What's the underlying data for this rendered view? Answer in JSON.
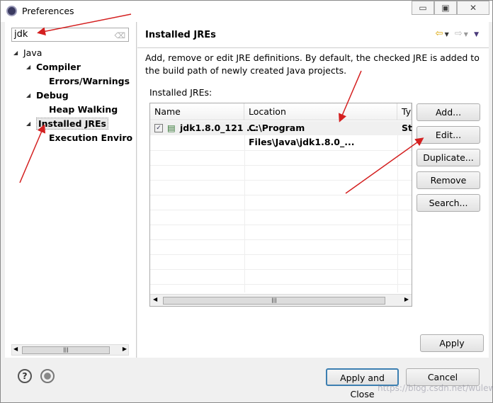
{
  "window": {
    "title": "Preferences",
    "controls": [
      "▭",
      "▣",
      "✕"
    ]
  },
  "filter": {
    "value": "jdk"
  },
  "tree": [
    {
      "label": "Java",
      "expanded": true,
      "depth": 0
    },
    {
      "label": "Compiler",
      "depth": 1,
      "expanded": true
    },
    {
      "label": "Errors/Warnings",
      "depth": 2
    },
    {
      "label": "Debug",
      "depth": 1,
      "expanded": true
    },
    {
      "label": "Heap Walking",
      "depth": 2
    },
    {
      "label": "Installed JREs",
      "depth": 1,
      "expanded": true,
      "selected": true
    },
    {
      "label": "Execution Enviro",
      "depth": 2
    }
  ],
  "page": {
    "title": "Installed JREs",
    "description": "Add, remove or edit JRE definitions. By default, the checked JRE is added to the build path of newly created Java projects.",
    "table_label": "Installed JREs:",
    "columns": [
      "Name",
      "Location",
      "Ty"
    ],
    "rows": [
      {
        "checked": true,
        "name": "jdk1.8.0_121 ...",
        "location": "C:\\Program Files\\Java\\jdk1.8.0_...",
        "type": "St"
      }
    ],
    "buttons": {
      "add": "Add...",
      "edit": "Edit...",
      "duplicate": "Duplicate...",
      "remove": "Remove",
      "search": "Search..."
    },
    "apply": "Apply"
  },
  "footer": {
    "apply_close": "Apply and Close",
    "cancel": "Cancel",
    "help": "?"
  },
  "watermark": "https://blog.csdn.net/wulewu",
  "colors": {
    "annotation_arrow": "#d42020",
    "default_button_border": "#3c7fb1"
  }
}
